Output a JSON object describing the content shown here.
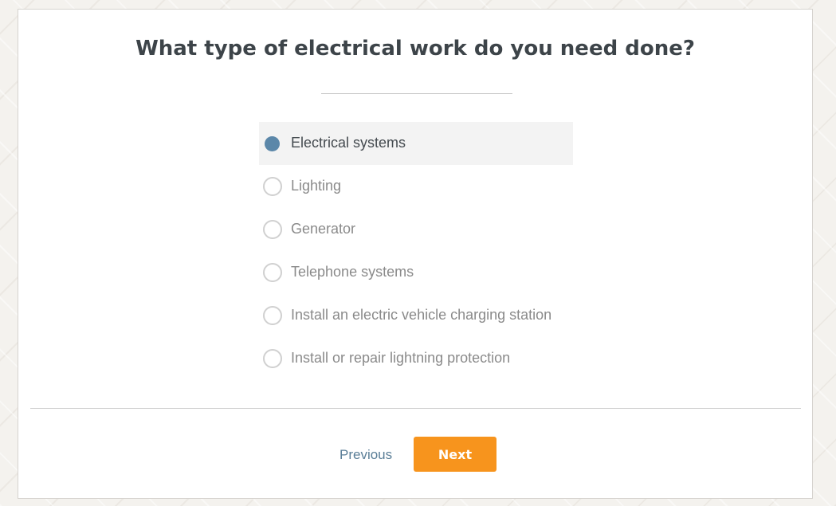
{
  "question": {
    "title": "What type of electrical work do you need done?"
  },
  "options": [
    {
      "label": "Electrical systems",
      "selected": true
    },
    {
      "label": "Lighting",
      "selected": false
    },
    {
      "label": "Generator",
      "selected": false
    },
    {
      "label": "Telephone systems",
      "selected": false
    },
    {
      "label": "Install an electric vehicle charging station",
      "selected": false
    },
    {
      "label": "Install or repair lightning protection",
      "selected": false
    }
  ],
  "navigation": {
    "previous_label": "Previous",
    "next_label": "Next"
  },
  "colors": {
    "accent": "#f7941d",
    "selected_radio": "#5b87a9",
    "link": "#5a7e97",
    "title": "#3d4449"
  }
}
